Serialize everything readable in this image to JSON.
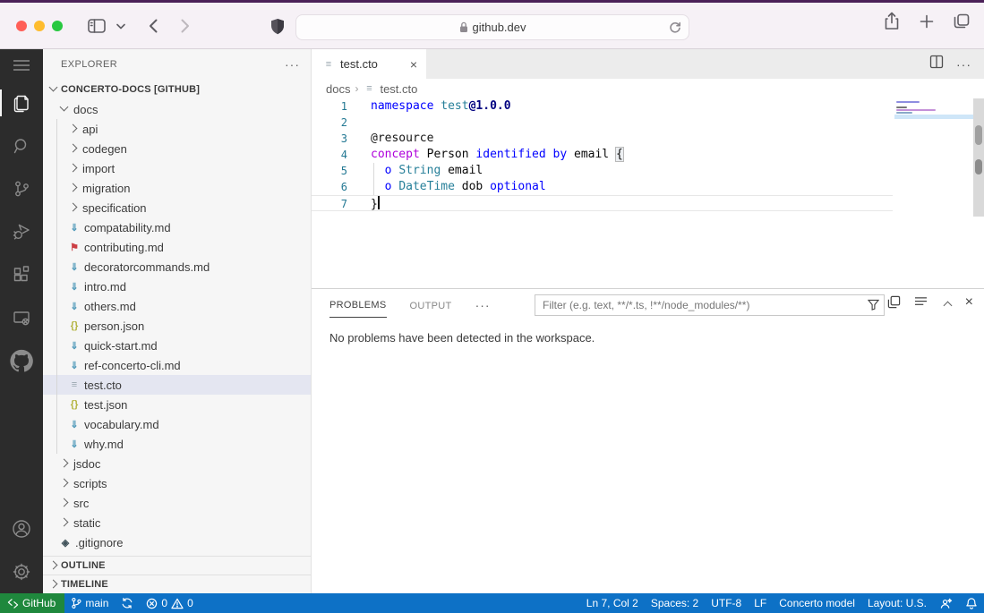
{
  "colors": {
    "keyword": "#0000ff",
    "type": "#267f99",
    "control": "#af00db",
    "identifier": "#0a0a0a",
    "decorator": "#161616",
    "version": "#000080",
    "linenum": "#237893",
    "statusbar": "#0d71c6",
    "badge": "#1f883d",
    "selection": "#e4e6f1",
    "activitybar": "#2c2c2c",
    "sidebar": "#f6f6f6",
    "tabbar": "#ececec",
    "chrome-top": "#4b2158"
  },
  "browser": {
    "url": "github.dev"
  },
  "activity_bar": {
    "items": [
      "menu",
      "explorer",
      "search",
      "source-control",
      "run-debug",
      "extensions",
      "remote-explorer",
      "github",
      "account",
      "settings"
    ],
    "active": "explorer"
  },
  "icon_glyphs": {
    "markdown-icon": {
      "ch": "⇓",
      "color": "#519aba"
    },
    "json-icon": {
      "ch": "{}",
      "color": "#b3b33e"
    },
    "file-icon": {
      "ch": "≡",
      "color": "#9aa7b0"
    },
    "ribbon-icon": {
      "ch": "⚑",
      "color": "#cc3e44"
    },
    "git-icon": {
      "ch": "◈",
      "color": "#41535b"
    }
  },
  "sidebar": {
    "title": "EXPLORER",
    "more_label": "···",
    "root_label": "CONCERTO-DOCS [GITHUB]",
    "outline_label": "OUTLINE",
    "timeline_label": "TIMELINE",
    "tree": [
      {
        "label": "docs",
        "kind": "folder",
        "expanded": true,
        "level": 1
      },
      {
        "label": "api",
        "kind": "folder",
        "level": 2,
        "guide": true
      },
      {
        "label": "codegen",
        "kind": "folder",
        "level": 2,
        "guide": true
      },
      {
        "label": "import",
        "kind": "folder",
        "level": 2,
        "guide": true
      },
      {
        "label": "migration",
        "kind": "folder",
        "level": 2,
        "guide": true
      },
      {
        "label": "specification",
        "kind": "folder",
        "level": 2,
        "guide": true
      },
      {
        "label": "compatability.md",
        "kind": "file",
        "icon": "markdown-icon",
        "level": 2,
        "guide": true
      },
      {
        "label": "contributing.md",
        "kind": "file",
        "icon": "ribbon-icon",
        "level": 2,
        "guide": true
      },
      {
        "label": "decoratorcommands.md",
        "kind": "file",
        "icon": "markdown-icon",
        "level": 2,
        "guide": true
      },
      {
        "label": "intro.md",
        "kind": "file",
        "icon": "markdown-icon",
        "level": 2,
        "guide": true
      },
      {
        "label": "others.md",
        "kind": "file",
        "icon": "markdown-icon",
        "level": 2,
        "guide": true
      },
      {
        "label": "person.json",
        "kind": "file",
        "icon": "json-icon",
        "level": 2,
        "guide": true
      },
      {
        "label": "quick-start.md",
        "kind": "file",
        "icon": "markdown-icon",
        "level": 2,
        "guide": true
      },
      {
        "label": "ref-concerto-cli.md",
        "kind": "file",
        "icon": "markdown-icon",
        "level": 2,
        "guide": true
      },
      {
        "label": "test.cto",
        "kind": "file",
        "icon": "file-icon",
        "level": 2,
        "guide": true,
        "selected": true
      },
      {
        "label": "test.json",
        "kind": "file",
        "icon": "json-icon",
        "level": 2,
        "guide": true
      },
      {
        "label": "vocabulary.md",
        "kind": "file",
        "icon": "markdown-icon",
        "level": 2,
        "guide": true
      },
      {
        "label": "why.md",
        "kind": "file",
        "icon": "markdown-icon",
        "level": 2,
        "guide": true
      },
      {
        "label": "jsdoc",
        "kind": "folder",
        "level": 1
      },
      {
        "label": "scripts",
        "kind": "folder",
        "level": 1
      },
      {
        "label": "src",
        "kind": "folder",
        "level": 1
      },
      {
        "label": "static",
        "kind": "folder",
        "level": 1
      },
      {
        "label": ".gitignore",
        "kind": "file",
        "icon": "git-icon",
        "level": 1
      }
    ]
  },
  "editor": {
    "tab": {
      "label": "test.cto",
      "close_label": "×"
    },
    "more_label": "···",
    "breadcrumb": {
      "folder": "docs",
      "sep": "›",
      "file": "test.cto"
    },
    "code": {
      "lines": [
        {
          "num": 1,
          "tokens": [
            {
              "t": "namespace ",
              "c": "keyword"
            },
            {
              "t": "test",
              "c": "type"
            },
            {
              "t": "@1.0.0",
              "c": "version"
            }
          ]
        },
        {
          "num": 2,
          "tokens": []
        },
        {
          "num": 3,
          "tokens": [
            {
              "t": "@resource",
              "c": "decorator"
            }
          ]
        },
        {
          "num": 4,
          "tokens": [
            {
              "t": "concept ",
              "c": "control"
            },
            {
              "t": "Person ",
              "c": "identifier"
            },
            {
              "t": "identified by ",
              "c": "keyword"
            },
            {
              "t": "email ",
              "c": "identifier"
            },
            {
              "t": "{",
              "c": "brace"
            }
          ]
        },
        {
          "num": 5,
          "iguide": true,
          "tokens": [
            {
              "t": "  "
            },
            {
              "t": "o ",
              "c": "keyword"
            },
            {
              "t": "String ",
              "c": "type"
            },
            {
              "t": "email",
              "c": "identifier"
            }
          ]
        },
        {
          "num": 6,
          "iguide": true,
          "tokens": [
            {
              "t": "  "
            },
            {
              "t": "o ",
              "c": "keyword"
            },
            {
              "t": "DateTime ",
              "c": "type"
            },
            {
              "t": "dob ",
              "c": "identifier"
            },
            {
              "t": "optional",
              "c": "keyword"
            }
          ]
        },
        {
          "num": 7,
          "current": true,
          "cursor": true,
          "tokens": [
            {
              "t": "}",
              "c": "identifier"
            }
          ]
        }
      ]
    }
  },
  "panel": {
    "tabs": [
      {
        "label": "PROBLEMS"
      },
      {
        "label": "OUTPUT"
      }
    ],
    "more_label": "···",
    "filter_placeholder": "Filter (e.g. text, **/*.ts, !**/node_modules/**)",
    "close_label": "×",
    "message": "No problems have been detected in the workspace."
  },
  "status_bar": {
    "remote_label": "GitHub",
    "branch_label": "main",
    "error_count": "0",
    "warning_count": "0",
    "line_col": "Ln 7, Col 2",
    "spaces": "Spaces: 2",
    "encoding": "UTF-8",
    "eol": "LF",
    "language": "Concerto model",
    "layout": "Layout: U.S."
  }
}
